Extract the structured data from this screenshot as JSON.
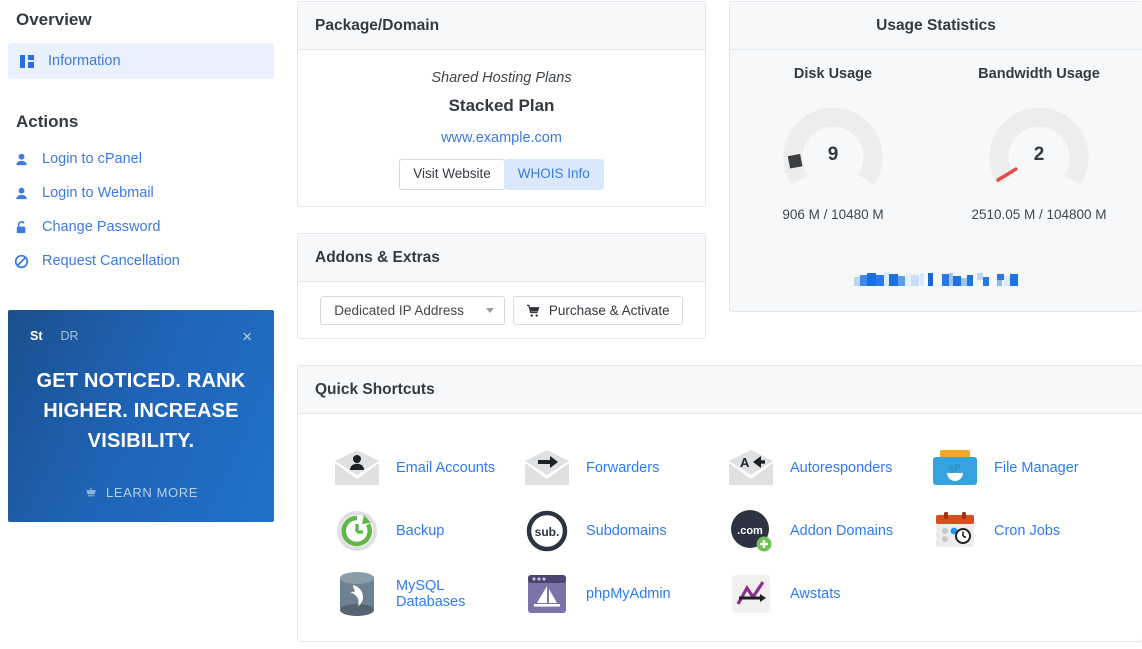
{
  "sidebar": {
    "overview_title": "Overview",
    "actions_title": "Actions",
    "nav": [
      {
        "label": "Information",
        "icon": "grid-icon",
        "active": true
      }
    ],
    "actions": [
      {
        "label": "Login to cPanel",
        "icon": "user-icon"
      },
      {
        "label": "Login to Webmail",
        "icon": "user-icon"
      },
      {
        "label": "Change Password",
        "icon": "lock-icon"
      },
      {
        "label": "Request Cancellation",
        "icon": "ban-icon"
      }
    ]
  },
  "promo": {
    "tab_active": "St",
    "tab_inactive": "DR",
    "close": "×",
    "headline": "GET NOTICED. RANK HIGHER. INCREASE VISIBILITY.",
    "cta": "LEARN MORE",
    "cta_icon": "cart-icon",
    "gradient_from": "#1b4f8c",
    "gradient_to": "#2171cc"
  },
  "package_card": {
    "title": "Package/Domain",
    "group": "Shared Hosting Plans",
    "plan": "Stacked Plan",
    "domain": "www.example.com",
    "visit_button": "Visit Website",
    "whois_button": "WHOIS Info"
  },
  "addons_card": {
    "title": "Addons & Extras",
    "select_value": "Dedicated IP Address",
    "purchase_button": "Purchase & Activate",
    "purchase_icon": "cart-icon"
  },
  "usage_card": {
    "title": "Usage Statistics",
    "disk": {
      "title": "Disk Usage",
      "value": "9",
      "detail": "906 M / 10480 M",
      "needle_color": "#3c3f42"
    },
    "bandwidth": {
      "title": "Bandwidth Usage",
      "value": "2",
      "detail": "2510.05 M / 104800 M",
      "needle_color": "#e04b4b"
    },
    "track_color": "#ededed"
  },
  "shortcuts_card": {
    "title": "Quick Shortcuts",
    "items": [
      {
        "label": "Email Accounts",
        "icon": "email-accounts-icon"
      },
      {
        "label": "Forwarders",
        "icon": "forwarders-icon"
      },
      {
        "label": "Autoresponders",
        "icon": "autoresponders-icon"
      },
      {
        "label": "File Manager",
        "icon": "file-manager-icon"
      },
      {
        "label": "Backup",
        "icon": "backup-icon"
      },
      {
        "label": "Subdomains",
        "icon": "subdomains-icon"
      },
      {
        "label": "Addon Domains",
        "icon": "addon-domains-icon"
      },
      {
        "label": "Cron Jobs",
        "icon": "cron-jobs-icon"
      },
      {
        "label": "MySQL Databases",
        "icon": "mysql-databases-icon"
      },
      {
        "label": "phpMyAdmin",
        "icon": "phpmyadmin-icon"
      },
      {
        "label": "Awstats",
        "icon": "awstats-icon"
      }
    ]
  },
  "chart_data": [
    {
      "type": "gauge",
      "title": "Disk Usage",
      "value": 9,
      "unit": "%",
      "used": 906,
      "total": 10480,
      "units": "M",
      "label": "906 M / 10480 M",
      "range": [
        0,
        100
      ]
    },
    {
      "type": "gauge",
      "title": "Bandwidth Usage",
      "value": 2,
      "unit": "%",
      "used": 2510.05,
      "total": 104800,
      "units": "M",
      "label": "2510.05 M / 104800 M",
      "range": [
        0,
        100
      ]
    }
  ],
  "colors": {
    "link": "#3c7ae4",
    "shortcut_link": "#2d7bf4",
    "nav_active_bg": "#eaf1fe",
    "card_border": "#e3e6ea",
    "card_head_bg": "#f7f8f9"
  }
}
